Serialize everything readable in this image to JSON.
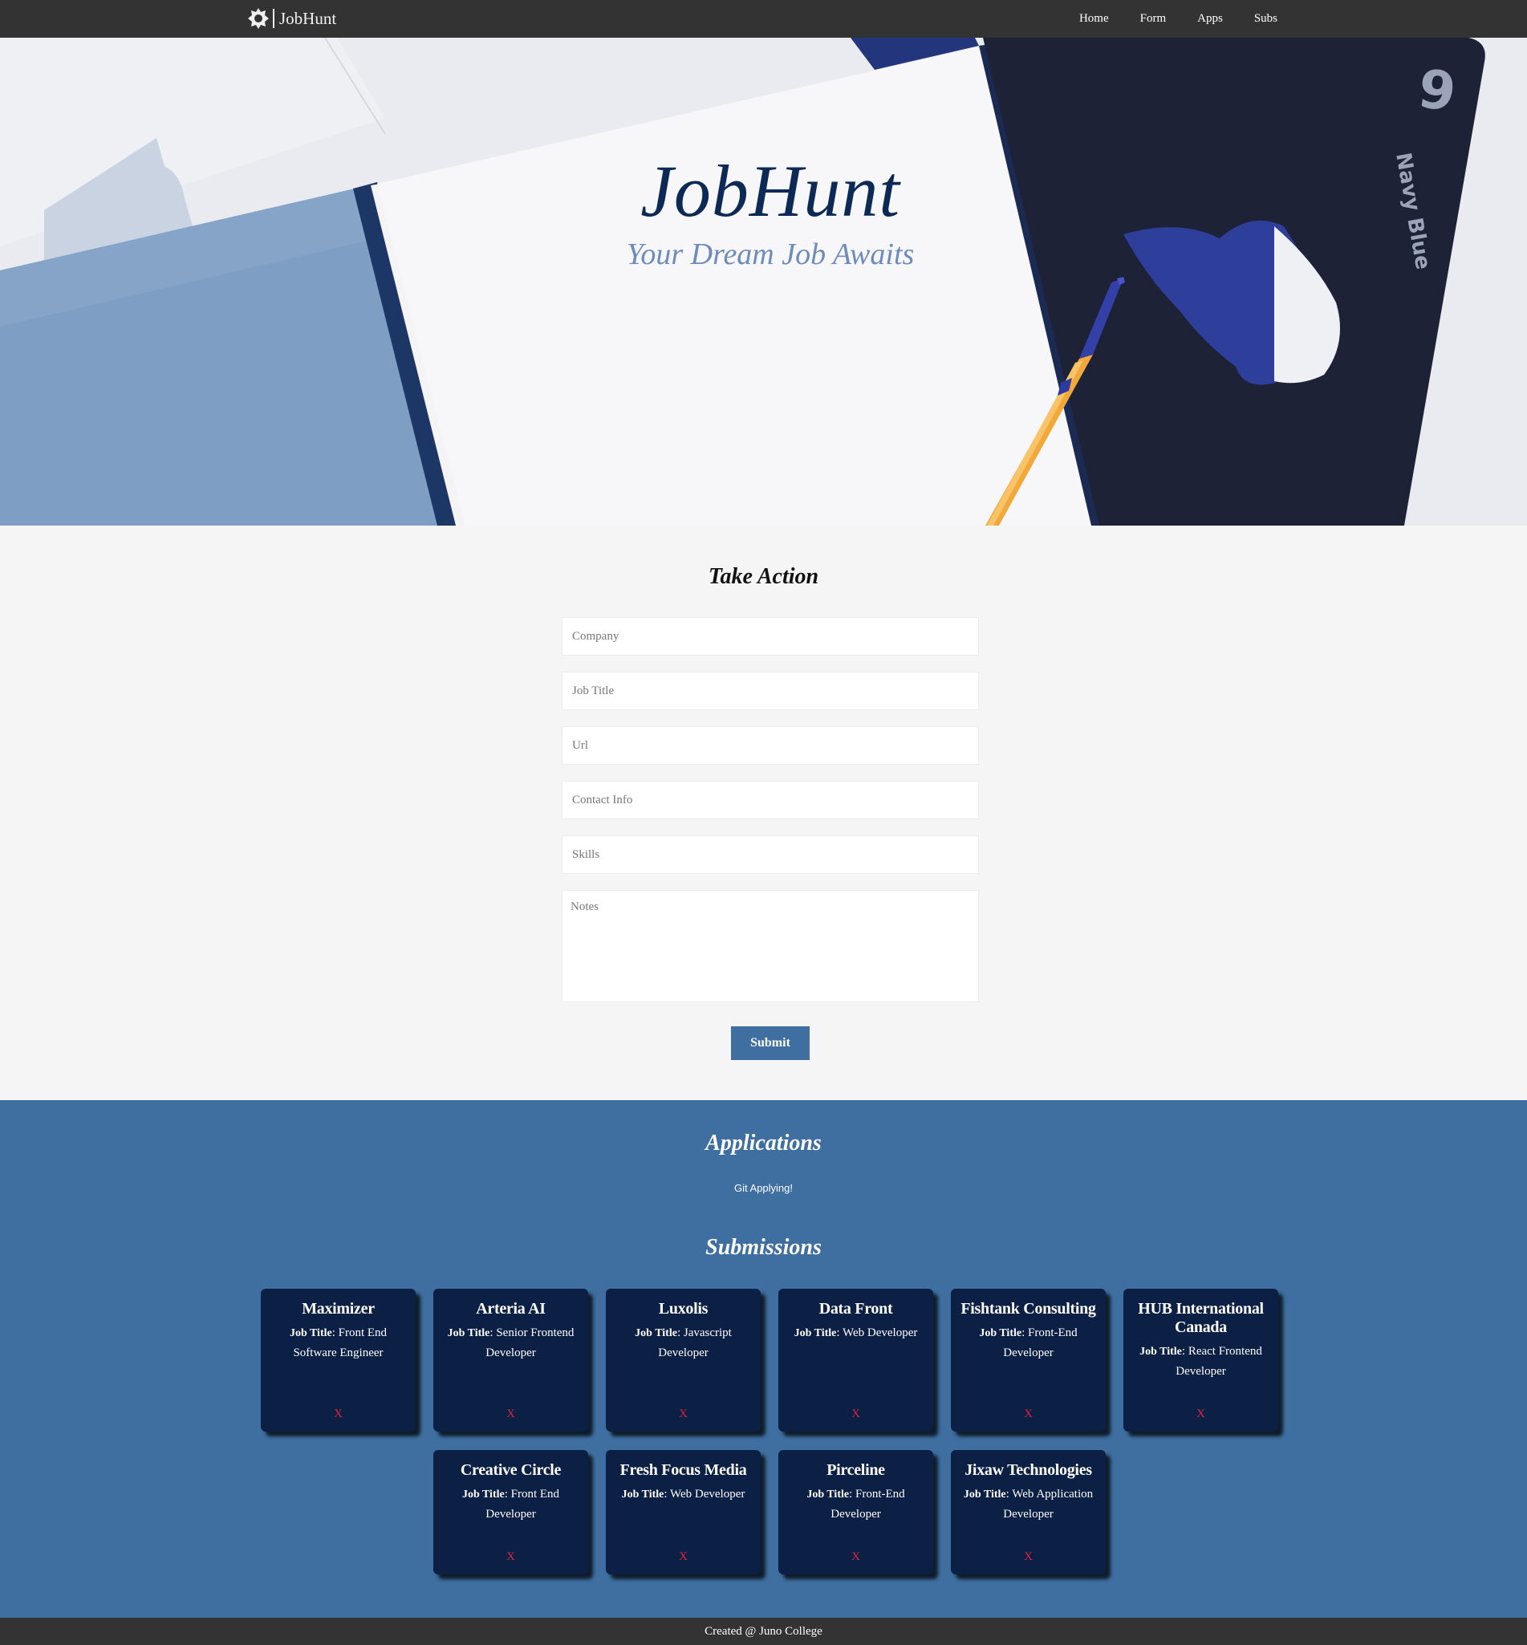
{
  "nav": {
    "brand": "JobHunt",
    "brand_icon": "gear-icon",
    "links": [
      "Home",
      "Form",
      "Apps",
      "Subs"
    ]
  },
  "hero": {
    "title": "JobHunt",
    "subtitle": "Your Dream Job Awaits",
    "image_text": "Navy Blue",
    "image_number": "9"
  },
  "form": {
    "title": "Take Action",
    "company_placeholder": "Company",
    "job_title_placeholder": "Job Title",
    "url_placeholder": "Url",
    "contact_placeholder": "Contact Info",
    "skills_placeholder": "Skills",
    "notes_placeholder": "Notes",
    "submit_label": "Submit"
  },
  "applications": {
    "title": "Applications",
    "link_text": "Git Applying!",
    "submissions_title": "Submissions",
    "job_title_label": "Job Title",
    "delete_label": "X",
    "cards": [
      {
        "company": "Maximizer",
        "job": "Front End Software Engineer"
      },
      {
        "company": "Arteria AI",
        "job": "Senior Frontend Developer"
      },
      {
        "company": "Luxolis",
        "job": "Javascript Developer"
      },
      {
        "company": "Data Front",
        "job": "Web Developer"
      },
      {
        "company": "Fishtank Consulting",
        "job": "Front-End Developer"
      },
      {
        "company": "HUB International Canada",
        "job": "React Frontend Developer"
      },
      {
        "company": "Creative Circle",
        "job": "Front End Developer"
      },
      {
        "company": "Fresh Focus Media",
        "job": "Web Developer"
      },
      {
        "company": "Pirceline",
        "job": "Front-End Developer"
      },
      {
        "company": "Jixaw Technologies",
        "job": "Web Application Developer"
      }
    ]
  },
  "footer": {
    "text": "Created @ Juno College"
  },
  "colors": {
    "nav_bg": "#333333",
    "accent": "#3e6fa0",
    "card_bg": "#0c1f44",
    "delete": "#e0243f",
    "hero_title": "#0c2a55",
    "hero_subtitle": "#6e8bbd"
  }
}
